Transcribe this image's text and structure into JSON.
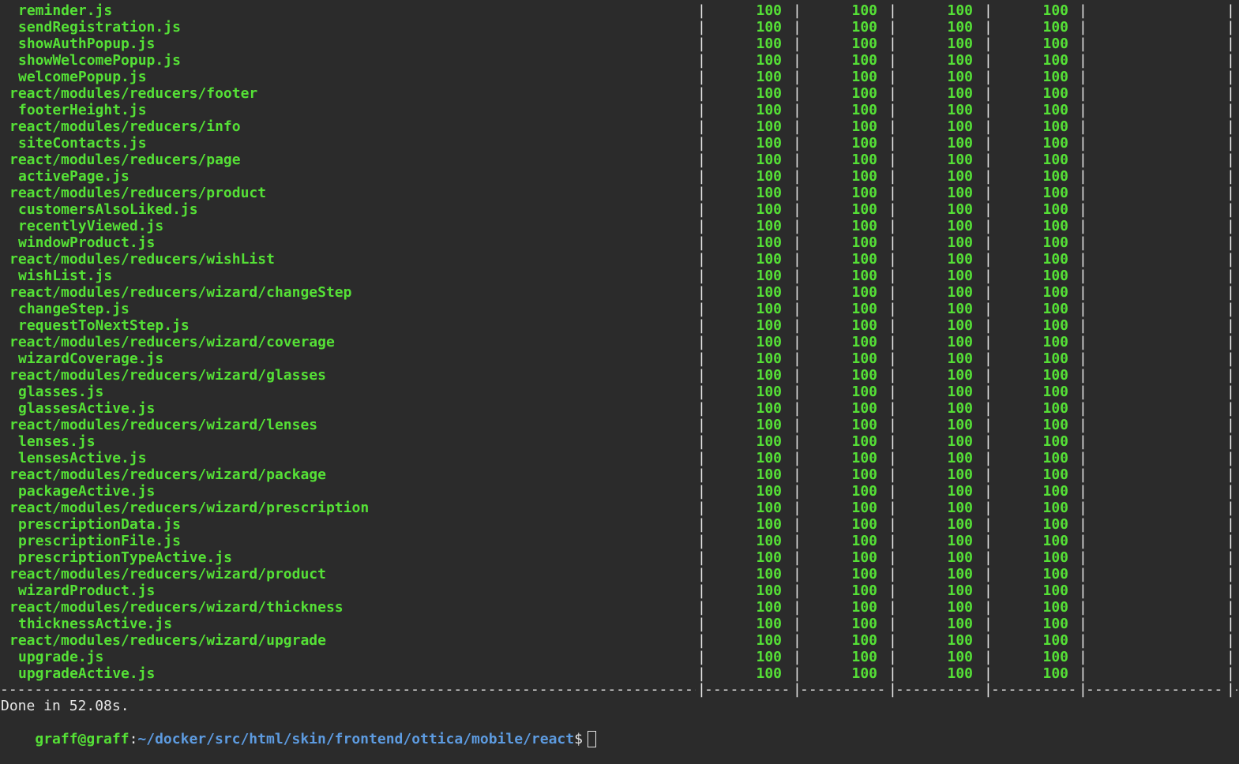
{
  "rows": [
    {
      "name": "reminder.js",
      "kind": "file",
      "values": [
        "100",
        "100",
        "100",
        "100"
      ]
    },
    {
      "name": "sendRegistration.js",
      "kind": "file",
      "values": [
        "100",
        "100",
        "100",
        "100"
      ]
    },
    {
      "name": "showAuthPopup.js",
      "kind": "file",
      "values": [
        "100",
        "100",
        "100",
        "100"
      ]
    },
    {
      "name": "showWelcomePopup.js",
      "kind": "file",
      "values": [
        "100",
        "100",
        "100",
        "100"
      ]
    },
    {
      "name": "welcomePopup.js",
      "kind": "file",
      "values": [
        "100",
        "100",
        "100",
        "100"
      ]
    },
    {
      "name": "react/modules/reducers/footer",
      "kind": "dir",
      "values": [
        "100",
        "100",
        "100",
        "100"
      ]
    },
    {
      "name": "footerHeight.js",
      "kind": "file",
      "values": [
        "100",
        "100",
        "100",
        "100"
      ]
    },
    {
      "name": "react/modules/reducers/info",
      "kind": "dir",
      "values": [
        "100",
        "100",
        "100",
        "100"
      ]
    },
    {
      "name": "siteContacts.js",
      "kind": "file",
      "values": [
        "100",
        "100",
        "100",
        "100"
      ]
    },
    {
      "name": "react/modules/reducers/page",
      "kind": "dir",
      "values": [
        "100",
        "100",
        "100",
        "100"
      ]
    },
    {
      "name": "activePage.js",
      "kind": "file",
      "values": [
        "100",
        "100",
        "100",
        "100"
      ]
    },
    {
      "name": "react/modules/reducers/product",
      "kind": "dir",
      "values": [
        "100",
        "100",
        "100",
        "100"
      ]
    },
    {
      "name": "customersAlsoLiked.js",
      "kind": "file",
      "values": [
        "100",
        "100",
        "100",
        "100"
      ]
    },
    {
      "name": "recentlyViewed.js",
      "kind": "file",
      "values": [
        "100",
        "100",
        "100",
        "100"
      ]
    },
    {
      "name": "windowProduct.js",
      "kind": "file",
      "values": [
        "100",
        "100",
        "100",
        "100"
      ]
    },
    {
      "name": "react/modules/reducers/wishList",
      "kind": "dir",
      "values": [
        "100",
        "100",
        "100",
        "100"
      ]
    },
    {
      "name": "wishList.js",
      "kind": "file",
      "values": [
        "100",
        "100",
        "100",
        "100"
      ]
    },
    {
      "name": "react/modules/reducers/wizard/changeStep",
      "kind": "dir",
      "values": [
        "100",
        "100",
        "100",
        "100"
      ]
    },
    {
      "name": "changeStep.js",
      "kind": "file",
      "values": [
        "100",
        "100",
        "100",
        "100"
      ]
    },
    {
      "name": "requestToNextStep.js",
      "kind": "file",
      "values": [
        "100",
        "100",
        "100",
        "100"
      ]
    },
    {
      "name": "react/modules/reducers/wizard/coverage",
      "kind": "dir",
      "values": [
        "100",
        "100",
        "100",
        "100"
      ]
    },
    {
      "name": "wizardCoverage.js",
      "kind": "file",
      "values": [
        "100",
        "100",
        "100",
        "100"
      ]
    },
    {
      "name": "react/modules/reducers/wizard/glasses",
      "kind": "dir",
      "values": [
        "100",
        "100",
        "100",
        "100"
      ]
    },
    {
      "name": "glasses.js",
      "kind": "file",
      "values": [
        "100",
        "100",
        "100",
        "100"
      ]
    },
    {
      "name": "glassesActive.js",
      "kind": "file",
      "values": [
        "100",
        "100",
        "100",
        "100"
      ]
    },
    {
      "name": "react/modules/reducers/wizard/lenses",
      "kind": "dir",
      "values": [
        "100",
        "100",
        "100",
        "100"
      ]
    },
    {
      "name": "lenses.js",
      "kind": "file",
      "values": [
        "100",
        "100",
        "100",
        "100"
      ]
    },
    {
      "name": "lensesActive.js",
      "kind": "file",
      "values": [
        "100",
        "100",
        "100",
        "100"
      ]
    },
    {
      "name": "react/modules/reducers/wizard/package",
      "kind": "dir",
      "values": [
        "100",
        "100",
        "100",
        "100"
      ]
    },
    {
      "name": "packageActive.js",
      "kind": "file",
      "values": [
        "100",
        "100",
        "100",
        "100"
      ]
    },
    {
      "name": "react/modules/reducers/wizard/prescription",
      "kind": "dir",
      "values": [
        "100",
        "100",
        "100",
        "100"
      ]
    },
    {
      "name": "prescriptionData.js",
      "kind": "file",
      "values": [
        "100",
        "100",
        "100",
        "100"
      ]
    },
    {
      "name": "prescriptionFile.js",
      "kind": "file",
      "values": [
        "100",
        "100",
        "100",
        "100"
      ]
    },
    {
      "name": "prescriptionTypeActive.js",
      "kind": "file",
      "values": [
        "100",
        "100",
        "100",
        "100"
      ]
    },
    {
      "name": "react/modules/reducers/wizard/product",
      "kind": "dir",
      "values": [
        "100",
        "100",
        "100",
        "100"
      ]
    },
    {
      "name": "wizardProduct.js",
      "kind": "file",
      "values": [
        "100",
        "100",
        "100",
        "100"
      ]
    },
    {
      "name": "react/modules/reducers/wizard/thickness",
      "kind": "dir",
      "values": [
        "100",
        "100",
        "100",
        "100"
      ]
    },
    {
      "name": "thicknessActive.js",
      "kind": "file",
      "values": [
        "100",
        "100",
        "100",
        "100"
      ]
    },
    {
      "name": "react/modules/reducers/wizard/upgrade",
      "kind": "dir",
      "values": [
        "100",
        "100",
        "100",
        "100"
      ]
    },
    {
      "name": "upgrade.js",
      "kind": "file",
      "values": [
        "100",
        "100",
        "100",
        "100"
      ]
    },
    {
      "name": "upgradeActive.js",
      "kind": "file",
      "values": [
        "100",
        "100",
        "100",
        "100"
      ]
    }
  ],
  "done_text": "Done in 52.08s.",
  "prompt": {
    "user_host": "graff@graff",
    "separator": ":",
    "path": "~/docker/src/html/skin/frontend/ottica/mobile/react",
    "symbol": "$"
  },
  "colors": {
    "background": "#2b2b2b",
    "green": "#55e036",
    "blue": "#5d9be0",
    "white": "#e6e6e6"
  }
}
